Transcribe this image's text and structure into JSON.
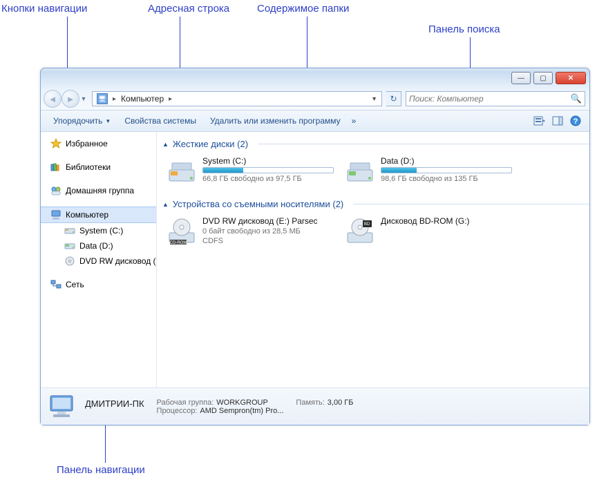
{
  "callouts": {
    "nav_buttons": "Кнопки навигации",
    "address_bar": "Адресная строка",
    "content": "Содержимое папки",
    "search_panel": "Панель поиска",
    "navigation_panel": "Панель навигации"
  },
  "titlebar": {
    "minimize": "—",
    "maximize": "▢",
    "close": "✕"
  },
  "breadcrumb": {
    "root_indicator": "▸",
    "location": "Компьютер",
    "trail": "▸"
  },
  "search": {
    "placeholder": "Поиск: Компьютер"
  },
  "cmdbar": {
    "organize": "Упорядочить",
    "props": "Свойства системы",
    "uninstall": "Удалить или изменить программу",
    "overflow": "»"
  },
  "navpane": {
    "favorites": "Избранное",
    "libraries": "Библиотеки",
    "homegroup": "Домашняя группа",
    "computer": "Компьютер",
    "system_c": "System (C:)",
    "data_d": "Data (D:)",
    "dvd": "DVD RW дисковод (",
    "network": "Сеть"
  },
  "groups": {
    "hdd": {
      "label": "Жесткие диски (2)"
    },
    "removable": {
      "label": "Устройства со съемными носителями (2)"
    }
  },
  "drives": {
    "c": {
      "name": "System (C:)",
      "sub": "66,8 ГБ свободно из 97,5 ГБ",
      "fill_pct": 31
    },
    "d": {
      "name": "Data (D:)",
      "sub": "98,6 ГБ свободно из 135 ГБ",
      "fill_pct": 27
    },
    "e": {
      "name": "DVD RW дисковод (E:) Parsec",
      "sub1": "0 байт свободно из 28,5 МБ",
      "sub2": "CDFS"
    },
    "g": {
      "name": "Дисковод BD-ROM (G:)"
    }
  },
  "details": {
    "computer_name": "ДМИТРИИ-ПК",
    "workgroup_label": "Рабочая группа:",
    "workgroup": "WORKGROUP",
    "cpu_label": "Процессор:",
    "cpu": "AMD Sempron(tm) Pro...",
    "mem_label": "Память:",
    "mem": "3,00 ГБ"
  }
}
